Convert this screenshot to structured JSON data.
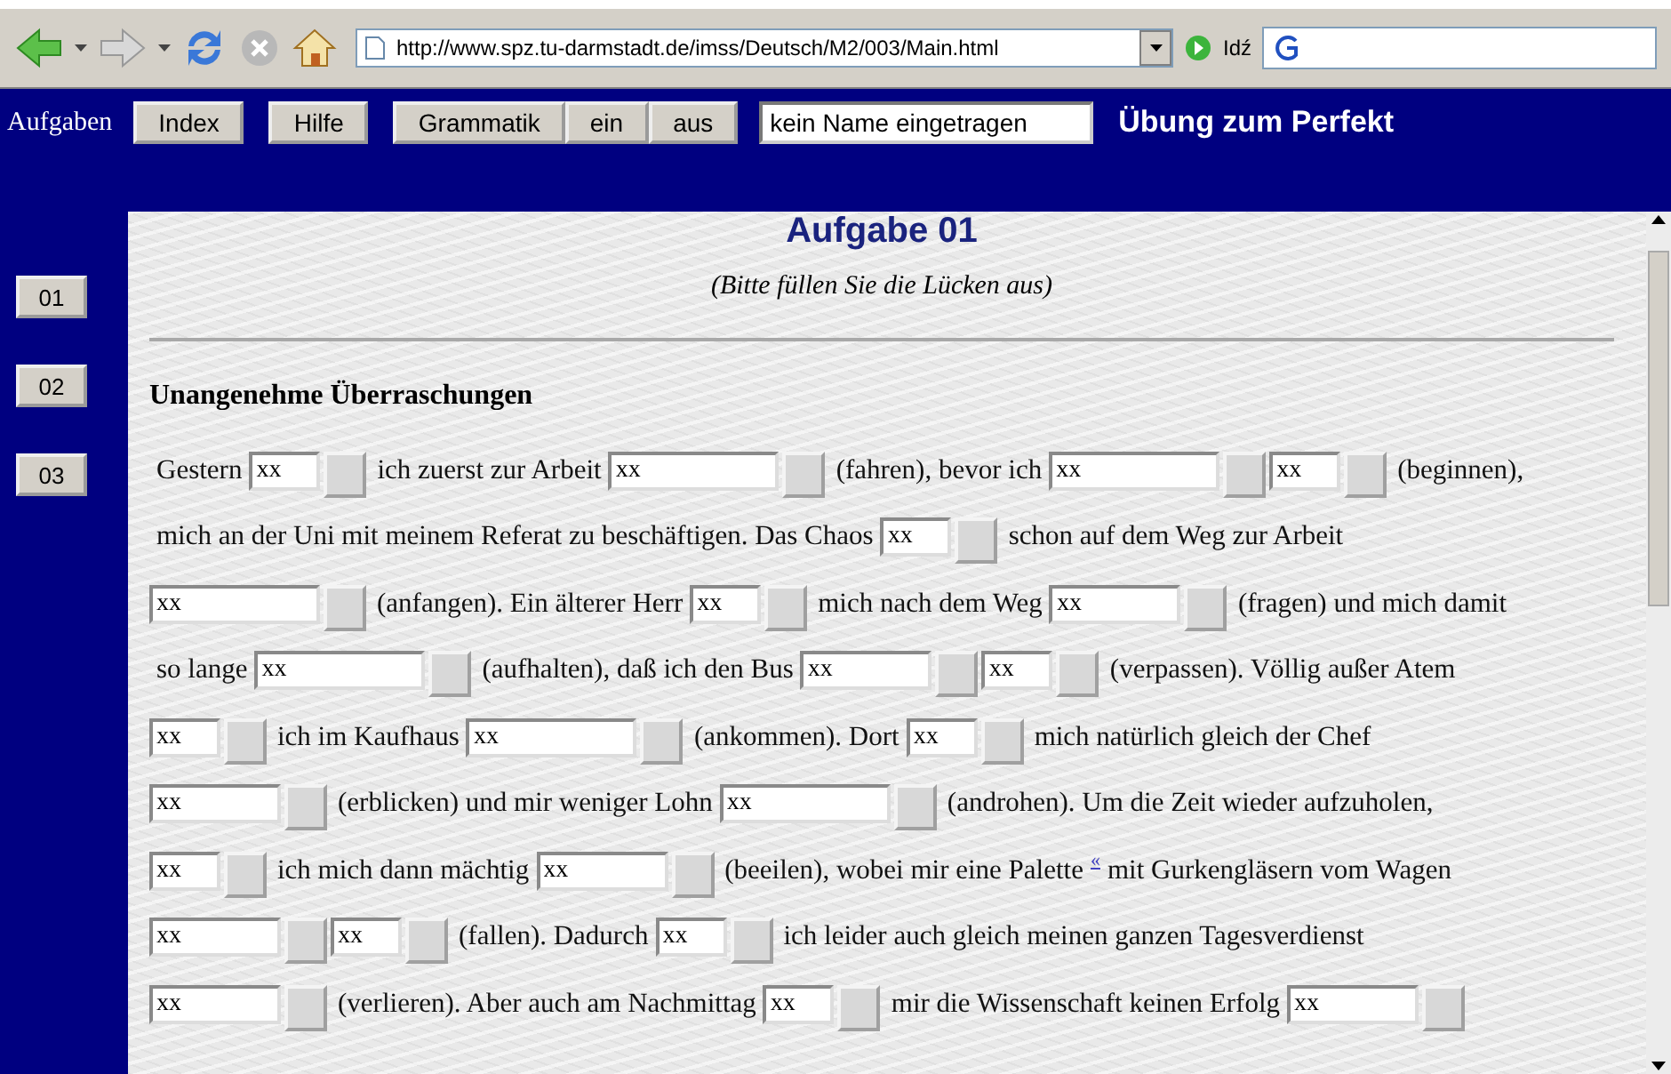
{
  "browser": {
    "address": "http://www.spz.tu-darmstadt.de/imss/Deutsch/M2/003/Main.html",
    "go_label": "Idź"
  },
  "nav": {
    "label": "Aufgaben",
    "buttons": [
      "Index",
      "Hilfe"
    ],
    "grammar_buttons": [
      "Grammatik",
      "ein",
      "aus"
    ],
    "name_field": "kein Name eingetragen",
    "title": "Übung zum Perfekt"
  },
  "sidebar": {
    "items": [
      "01",
      "02",
      "03"
    ]
  },
  "exercise": {
    "title": "Aufgabe 01",
    "instruction": "(Bitte füllen Sie die Lücken aus)",
    "heading": "Unangenehme Überraschungen",
    "lines": [
      [
        {
          "kind": "text",
          "text": "Gestern"
        },
        {
          "kind": "short-gap",
          "value": "xx"
        },
        {
          "kind": "text",
          "text": "ich zuerst zur Arbeit"
        },
        {
          "kind": "long-gap",
          "value": "xx"
        },
        {
          "kind": "text",
          "text": "(fahren), bevor ich"
        },
        {
          "kind": "long-gap",
          "value": "xx"
        },
        {
          "kind": "short-gap",
          "value": "xx"
        },
        {
          "kind": "text",
          "text": "(beginnen),"
        }
      ],
      [
        {
          "kind": "text",
          "text": "mich an der Uni mit meinem Referat zu beschäftigen. Das Chaos"
        },
        {
          "kind": "short-gap",
          "value": "xx"
        },
        {
          "kind": "text",
          "text": "schon auf dem Weg zur Arbeit"
        }
      ],
      [
        {
          "kind": "long-gap",
          "value": "xx"
        },
        {
          "kind": "text",
          "text": "(anfangen). Ein älterer Herr"
        },
        {
          "kind": "short-gap",
          "value": "xx"
        },
        {
          "kind": "text",
          "text": "mich nach dem Weg"
        },
        {
          "kind": "medium-gap",
          "value": "xx"
        },
        {
          "kind": "text",
          "text": "(fragen) und mich damit"
        }
      ],
      [
        {
          "kind": "text",
          "text": "so lange"
        },
        {
          "kind": "long-gap",
          "value": "xx"
        },
        {
          "kind": "text",
          "text": "(aufhalten), daß ich den Bus"
        },
        {
          "kind": "medium-gap",
          "value": "xx"
        },
        {
          "kind": "short-gap",
          "value": "xx"
        },
        {
          "kind": "text",
          "text": "(verpassen). Völlig außer Atem"
        }
      ],
      [
        {
          "kind": "short-gap",
          "value": "xx"
        },
        {
          "kind": "text",
          "text": "ich im Kaufhaus"
        },
        {
          "kind": "long-gap",
          "value": "xx"
        },
        {
          "kind": "text",
          "text": "(ankommen). Dort"
        },
        {
          "kind": "short-gap",
          "value": "xx"
        },
        {
          "kind": "text",
          "text": "mich natürlich gleich der Chef"
        }
      ],
      [
        {
          "kind": "medium-gap",
          "value": "xx"
        },
        {
          "kind": "text",
          "text": "(erblicken) und mir weniger Lohn"
        },
        {
          "kind": "long-gap",
          "value": "xx"
        },
        {
          "kind": "text",
          "text": "(androhen). Um die Zeit wieder aufzuholen,"
        }
      ],
      [
        {
          "kind": "short-gap",
          "value": "xx"
        },
        {
          "kind": "text",
          "text": "ich mich dann mächtig"
        },
        {
          "kind": "medium-gap",
          "value": "xx"
        },
        {
          "kind": "text",
          "text": "(beeilen), wobei mir eine Palette"
        },
        {
          "kind": "note",
          "text": "«"
        },
        {
          "kind": "text",
          "text": "mit Gurkengläsern vom Wagen"
        }
      ],
      [
        {
          "kind": "medium-gap",
          "value": "xx"
        },
        {
          "kind": "short-gap",
          "value": "xx"
        },
        {
          "kind": "text",
          "text": "(fallen). Dadurch"
        },
        {
          "kind": "short-gap",
          "value": "xx"
        },
        {
          "kind": "text",
          "text": "ich leider auch gleich meinen ganzen Tagesverdienst"
        }
      ],
      [
        {
          "kind": "medium-gap",
          "value": "xx"
        },
        {
          "kind": "text",
          "text": "(verlieren). Aber auch am Nachmittag"
        },
        {
          "kind": "short-gap",
          "value": "xx"
        },
        {
          "kind": "text",
          "text": "mir die Wissenschaft keinen Erfolg"
        },
        {
          "kind": "medium-gap",
          "value": "xx"
        }
      ]
    ]
  }
}
